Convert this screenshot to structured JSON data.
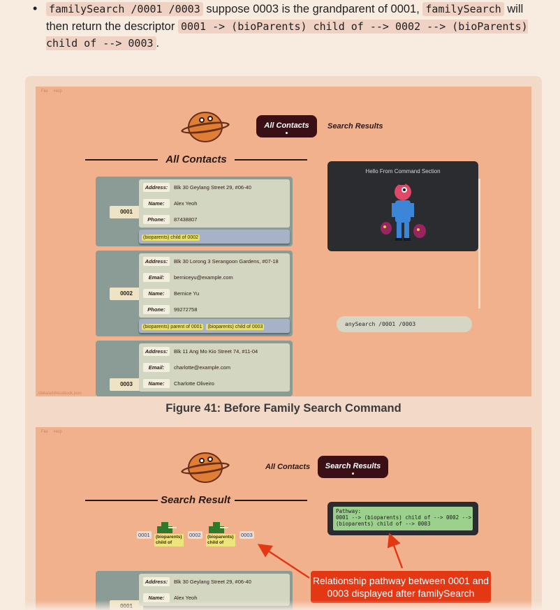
{
  "bullet": {
    "code1": "familySearch /0001 /0003",
    "text1": " suppose 0003 is the grandparent of 0001, ",
    "code2": "familySearch",
    "text2": " will then return the descriptor ",
    "code3": "0001 -> (bioParents) child of --> 0002 --> (bioParents) child of --> 0003",
    "text3": "."
  },
  "figure1": {
    "menu": [
      "File",
      "Help"
    ],
    "tab_active": "All Contacts",
    "tab_other": "Search Results",
    "section_title": "All Contacts",
    "command_hello": "Hello From Command Section",
    "command_input": "anySearch /0001 /0003",
    "footer_path": "./data/addressbook.json",
    "caption": "Figure 41: Before Family Search Command",
    "contacts": [
      {
        "id": "0001",
        "fields": [
          {
            "label": "Address:",
            "value": "Blk 30 Geylang Street 29, #06-40"
          },
          {
            "label": "Name:",
            "value": "Alex Yeoh"
          },
          {
            "label": "Phone:",
            "value": "87438807"
          }
        ],
        "relations": [
          "(bioparents) child of 0002"
        ]
      },
      {
        "id": "0002",
        "fields": [
          {
            "label": "Address:",
            "value": "Blk 30 Lorong 3 Serangoon Gardens, #07-18"
          },
          {
            "label": "Email:",
            "value": "berniceyu@example.com"
          },
          {
            "label": "Name:",
            "value": "Bernice Yu"
          },
          {
            "label": "Phone:",
            "value": "99272758"
          }
        ],
        "relations": [
          "(bioparents) parent of 0001",
          "(bioparents) child of 0003"
        ]
      },
      {
        "id": "0003",
        "fields": [
          {
            "label": "Address:",
            "value": "Blk 11 Ang Mo Kio Street 74, #11-04"
          },
          {
            "label": "Email:",
            "value": "charlotte@example.com"
          },
          {
            "label": "Name:",
            "value": "Charlotte Oliveiro"
          }
        ],
        "relations": []
      }
    ]
  },
  "figure2": {
    "menu": [
      "File",
      "Help"
    ],
    "tab_other": "All Contacts",
    "tab_active": "Search Results",
    "section_title": "Search Result",
    "pathway_text": "Pathway:\n0001 --> (bioparents) child of --> 0002 -->\n(bioparents) child of --> 0003",
    "nodes": [
      "0001",
      "0002",
      "0003"
    ],
    "edges": [
      "(bioparents)\nchild of",
      "(bioparents)\nchild of"
    ],
    "callout": "Relationship pathway between 0001 and 0003 displayed after familySearch",
    "contact": {
      "id": "0001",
      "fields": [
        {
          "label": "Address:",
          "value": "Blk 30 Geylang Street 29, #06-40"
        },
        {
          "label": "Name:",
          "value": "Alex Yeoh"
        }
      ]
    }
  },
  "colors": {
    "page_bg": "#f8ece1",
    "app_bg": "#f1b18d",
    "active_tab": "#3a1016",
    "card_bg": "#8b9b95",
    "callout": "#e43714",
    "pathway_bg": "#9bd08d"
  }
}
